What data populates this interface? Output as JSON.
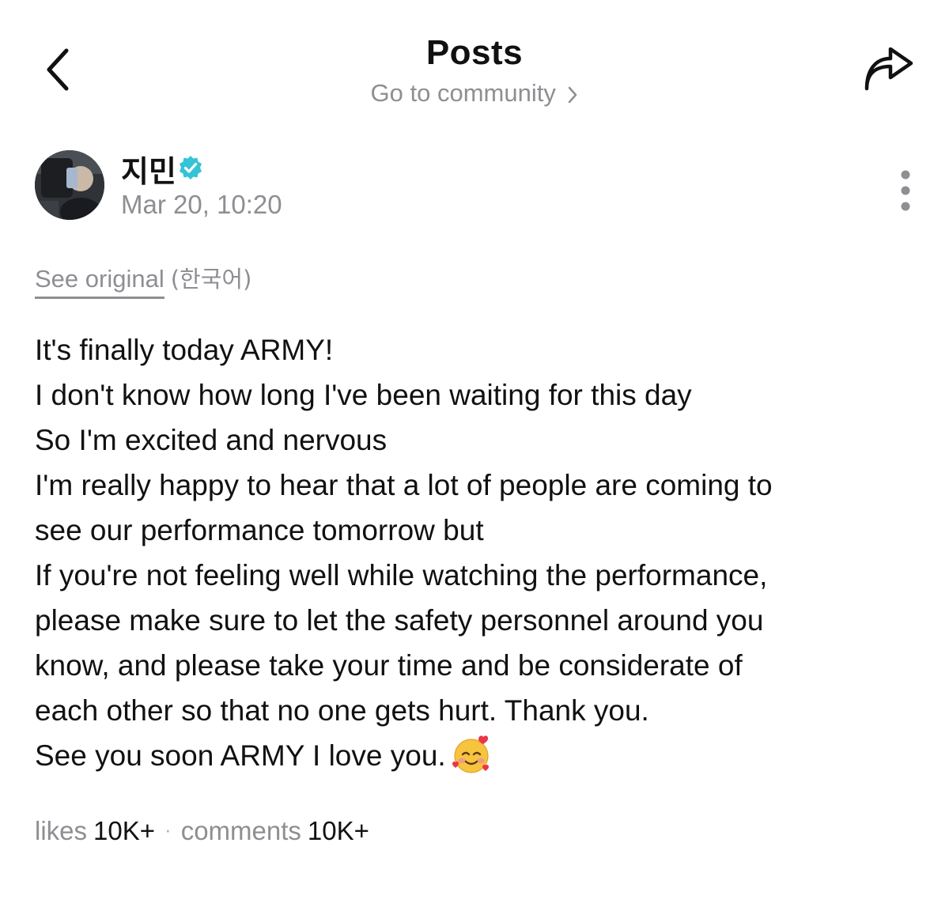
{
  "header": {
    "title": "Posts",
    "community_link": "Go to community",
    "back_icon": "chevron-left-icon",
    "share_icon": "share-arrow-icon"
  },
  "author": {
    "name": "지민",
    "verified_icon": "verified-badge-icon",
    "timestamp": "Mar 20, 10:20",
    "more_icon": "more-vertical-icon"
  },
  "translation": {
    "see_original": "See original",
    "language": "(한국어)"
  },
  "post": {
    "lines": [
      "It's finally today ARMY!",
      "I don't know how long I've been waiting for this day",
      "So I'm excited and nervous",
      "I'm really happy to hear that a lot of people are coming to",
      "see our performance tomorrow but",
      "If you're not feeling well while watching the performance,",
      "please make sure to let the safety personnel around you",
      "know, and please take your time and be considerate of",
      "each other so that no one gets hurt. Thank you.",
      "See you soon ARMY I love you."
    ],
    "emoji": "smiling-face-with-hearts"
  },
  "stats": {
    "likes_label": "likes",
    "likes_count": "10K+",
    "separator": "·",
    "comments_label": "comments",
    "comments_count": "10K+"
  },
  "colors": {
    "text": "#111111",
    "muted": "#8e8e93",
    "verified": "#35c3d6",
    "background": "#ffffff"
  }
}
